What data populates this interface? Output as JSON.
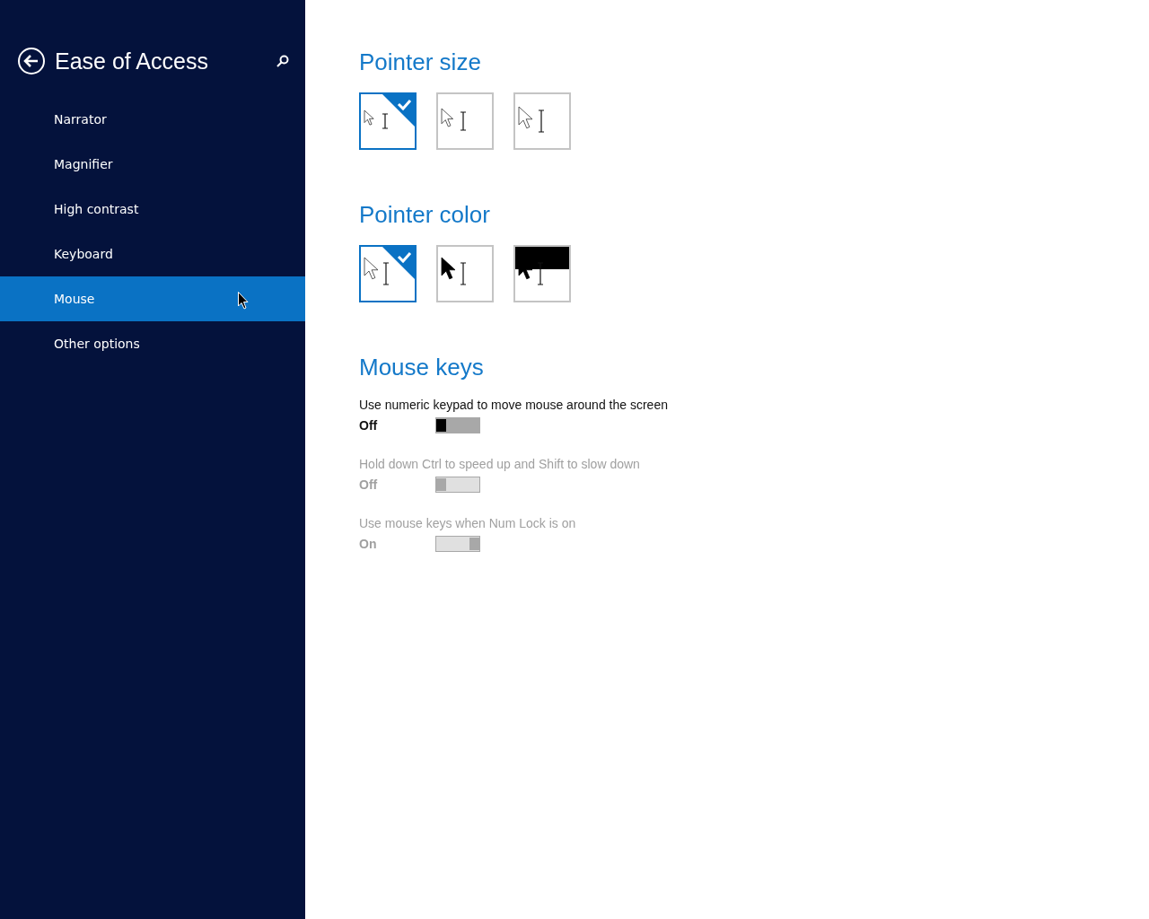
{
  "sidebar": {
    "title": "Ease of Access",
    "items": [
      {
        "label": "Narrator",
        "selected": false
      },
      {
        "label": "Magnifier",
        "selected": false
      },
      {
        "label": "High contrast",
        "selected": false
      },
      {
        "label": "Keyboard",
        "selected": false
      },
      {
        "label": "Mouse",
        "selected": true
      },
      {
        "label": "Other options",
        "selected": false
      }
    ]
  },
  "sections": [
    {
      "heading": "Pointer size",
      "options": [
        {
          "kind": "small",
          "selected": true
        },
        {
          "kind": "medium",
          "selected": false
        },
        {
          "kind": "large",
          "selected": false
        }
      ]
    },
    {
      "heading": "Pointer color",
      "options": [
        {
          "kind": "white",
          "selected": true
        },
        {
          "kind": "black",
          "selected": false
        },
        {
          "kind": "inverted",
          "selected": false
        }
      ]
    }
  ],
  "mouse_keys": {
    "heading": "Mouse keys",
    "settings": [
      {
        "label": "Use numeric keypad to move mouse around the screen",
        "state": "Off",
        "on": false,
        "disabled": false
      },
      {
        "label": "Hold down Ctrl to speed up and Shift to slow down",
        "state": "Off",
        "on": false,
        "disabled": true
      },
      {
        "label": "Use mouse keys when Num Lock is on",
        "state": "On",
        "on": true,
        "disabled": true
      }
    ]
  }
}
